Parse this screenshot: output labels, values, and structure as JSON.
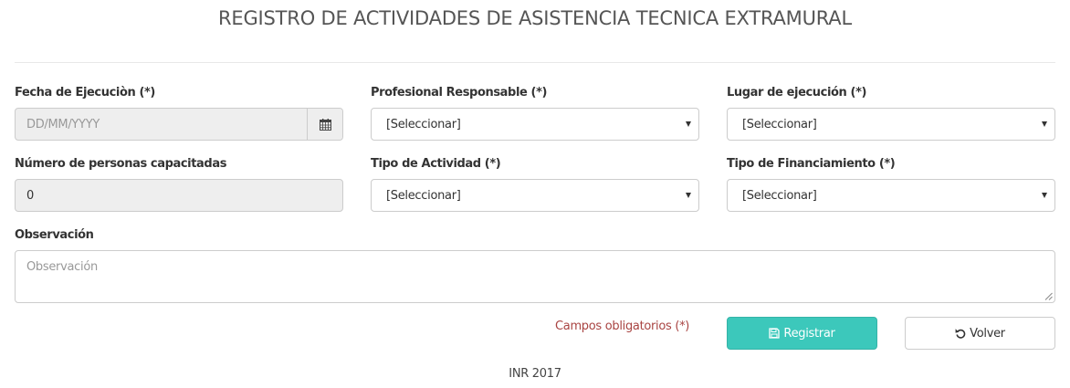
{
  "page": {
    "title": "REGISTRO DE ACTIVIDADES DE ASISTENCIA TECNICA EXTRAMURAL"
  },
  "form": {
    "fecha": {
      "label": "Fecha de Ejecuciòn (*)",
      "placeholder": "DD/MM/YYYY",
      "value": "",
      "icon": "calendar-icon"
    },
    "profesional": {
      "label": "Profesional Responsable (*)",
      "selected": "[Seleccionar]"
    },
    "lugar": {
      "label": "Lugar de ejecución (*)",
      "selected": "[Seleccionar]"
    },
    "personas": {
      "label": "Número de personas capacitadas",
      "value": "0"
    },
    "tipo_actividad": {
      "label": "Tipo de Actividad (*)",
      "selected": "[Seleccionar]"
    },
    "tipo_financiamiento": {
      "label": "Tipo de Financiamiento (*)",
      "selected": "[Seleccionar]"
    },
    "observacion": {
      "label": "Observación",
      "placeholder": "Observación",
      "value": ""
    },
    "required_note": "Campos obligatorios (*)",
    "buttons": {
      "registrar": {
        "label": "Registrar",
        "icon": "save-icon"
      },
      "volver": {
        "label": "Volver",
        "icon": "undo-icon"
      }
    }
  },
  "footer": {
    "text": "INR 2017"
  },
  "colors": {
    "primary_button": "#3cc8bb",
    "required_text": "#a94442",
    "disabled_field": "#eeeeee"
  }
}
